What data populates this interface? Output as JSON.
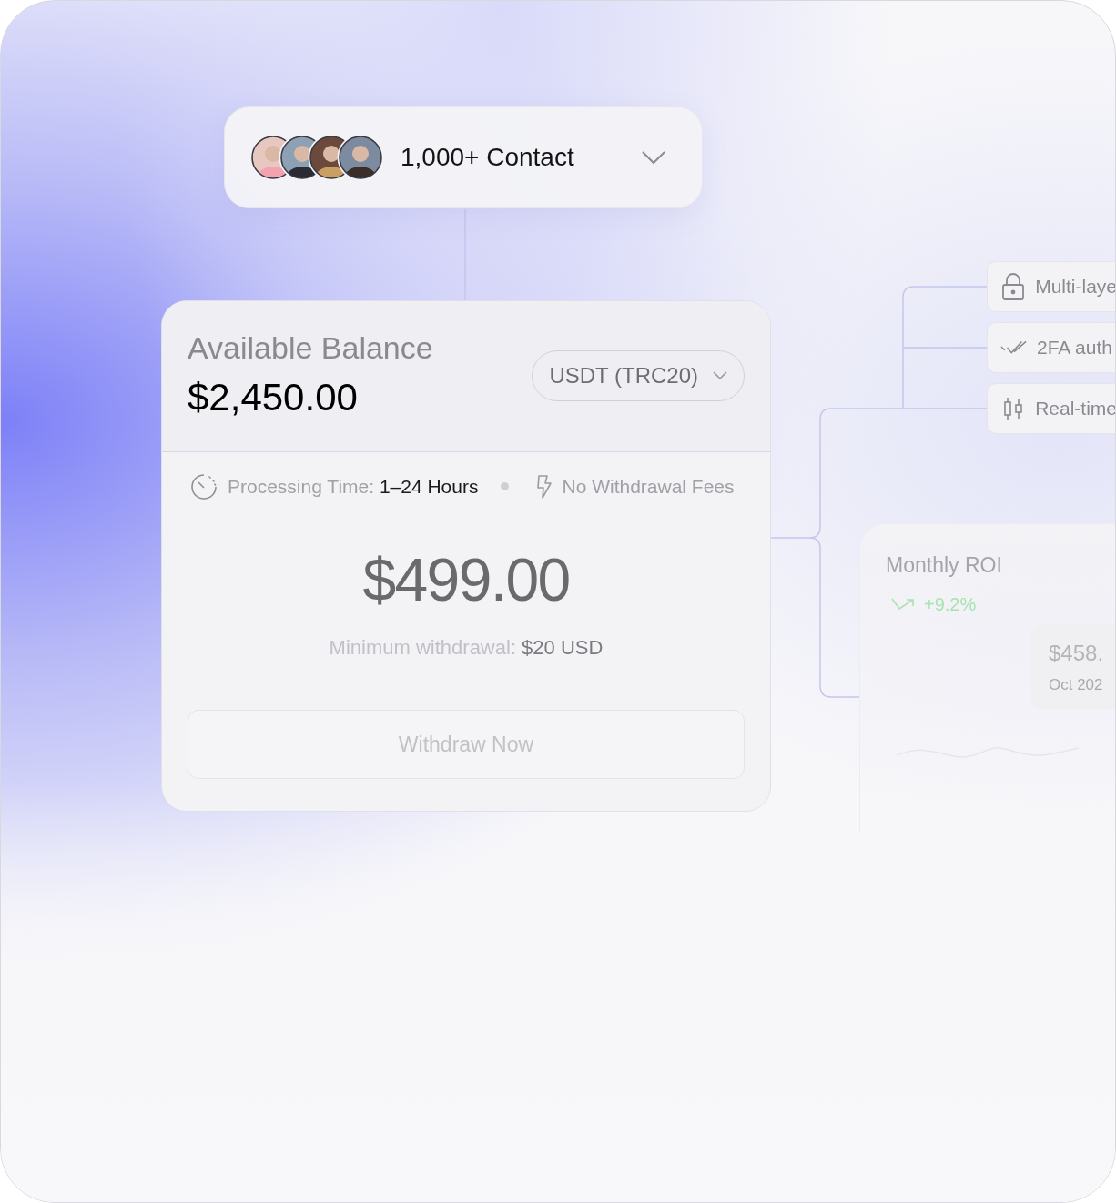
{
  "contacts": {
    "label": "1,000+ Contact"
  },
  "balance_card": {
    "title": "Available Balance",
    "amount": "$2,450.00",
    "currency": "USDT (TRC20)",
    "processing_label": "Processing Time:",
    "processing_value": "1–24 Hours",
    "fees": "No Withdrawal Fees",
    "withdraw_amount": "$499.00",
    "minimum_label": "Minimum withdrawal:",
    "minimum_value": "$20 USD",
    "button": "Withdraw Now"
  },
  "features": [
    {
      "kind": "lock",
      "label": "Multi-laye"
    },
    {
      "kind": "check",
      "label": "2FA auth"
    },
    {
      "kind": "candles",
      "label": "Real-time"
    }
  ],
  "roi_card": {
    "title": "Monthly ROI",
    "change": "+9.2%",
    "tooltip_value": "$458.",
    "tooltip_date": "Oct 202"
  }
}
